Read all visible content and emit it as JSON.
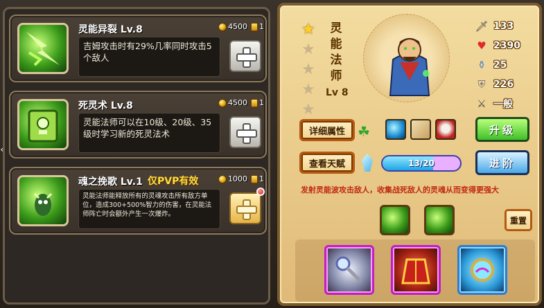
{
  "skills": [
    {
      "name": "灵能异裂 Lv.8",
      "cost": "4500",
      "scrolls": "1",
      "desc": "吉姆攻击时有29%几率同时攻击5个敌人",
      "icon": "psychic-rift-icon"
    },
    {
      "name": "死灵术 Lv.8",
      "cost": "4500",
      "scrolls": "1",
      "desc": "灵能法师可以在10级、20级、35级时学习新的死灵法术",
      "icon": "necromancy-book-icon"
    },
    {
      "name": "魂之挽歌 Lv.1",
      "pvp_tag": "仅PVP有效",
      "cost": "1000",
      "scrolls": "1",
      "desc": "灵能法师能释放所有的灵魂攻击所有敌方单位，造成300+500%智力的伤害，在灵能法师阵亡时会额外产生一次爆炸。",
      "icon": "soul-requiem-icon"
    }
  ],
  "hero": {
    "name": [
      "灵",
      "能",
      "法",
      "师"
    ],
    "level": "Lv 8",
    "stars_on": 1,
    "stars_total": 5,
    "stats": [
      {
        "icon": "sword-icon",
        "value": "133"
      },
      {
        "icon": "heart-icon",
        "value": "2390"
      },
      {
        "icon": "potion-icon",
        "value": "25"
      },
      {
        "icon": "shield-icon",
        "value": "226"
      },
      {
        "icon": "crossed-swords-icon",
        "value": "一般"
      }
    ],
    "description": "发射灵能波攻击敌人，收集战死敌人的灵魂从而变得更强大"
  },
  "buttons": {
    "details": "详细属性",
    "talent": "查看天赋",
    "upgrade": "升级",
    "advance": "进阶",
    "reset": "重置"
  },
  "talent_progress": {
    "text": "13/20",
    "fraction": 0.65
  },
  "colors": {
    "accent_gold": "#ffd02a",
    "desc_red": "#c02a10",
    "green_btn": "#3fbf2a",
    "blue_btn": "#4aa8e8"
  }
}
